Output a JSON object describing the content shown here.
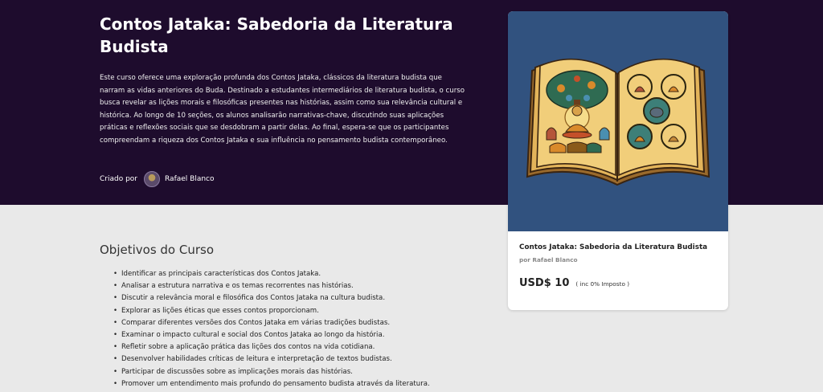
{
  "course": {
    "title": "Contos Jataka: Sabedoria da Literatura Budista",
    "description": "Este curso oferece uma exploração profunda dos Contos Jataka, clássicos da literatura budista que narram as vidas anteriores do Buda. Destinado a estudantes intermediários de literatura budista, o curso busca revelar as lições morais e filosóficas presentes nas histórias, assim como sua relevância cultural e histórica. Ao longo de 10 seções, os alunos analisarão narrativas-chave, discutindo suas aplicações práticas e reflexões sociais que se desdobram a partir delas. Ao final, espera-se que os participantes compreendam a riqueza dos Contos Jataka e sua influência no pensamento budista contemporâneo.",
    "created_by_label": "Criado por",
    "author": "Rafael Blanco"
  },
  "objectives": {
    "title": "Objetivos do Curso",
    "items": [
      "Identificar as principais características dos Contos Jataka.",
      "Analisar a estrutura narrativa e os temas recorrentes nas histórias.",
      "Discutir a relevância moral e filosófica dos Contos Jataka na cultura budista.",
      "Explorar as lições éticas que esses contos proporcionam.",
      "Comparar diferentes versões dos Contos Jataka em várias tradições budistas.",
      "Examinar o impacto cultural e social dos Contos Jataka ao longo da história.",
      "Refletir sobre a aplicação prática das lições dos contos na vida cotidiana.",
      "Desenvolver habilidades críticas de leitura e interpretação de textos budistas.",
      "Participar de discussões sobre as implicações morais das histórias.",
      "Promover um entendimento mais profundo do pensamento budista através da literatura."
    ]
  },
  "card": {
    "title": "Contos Jataka: Sabedoria da Literatura Budista",
    "author": "por Rafael Blanco",
    "price": "USD$ 10",
    "tax_note": "( inc 0% Imposto )"
  },
  "colors": {
    "hero_bg": "#1e0c2d",
    "page_bg": "#e9e9e9",
    "card_image_bg": "#31527f"
  },
  "icons": {
    "cover": "open-book-buddha-illustration",
    "avatar": "author-avatar"
  }
}
